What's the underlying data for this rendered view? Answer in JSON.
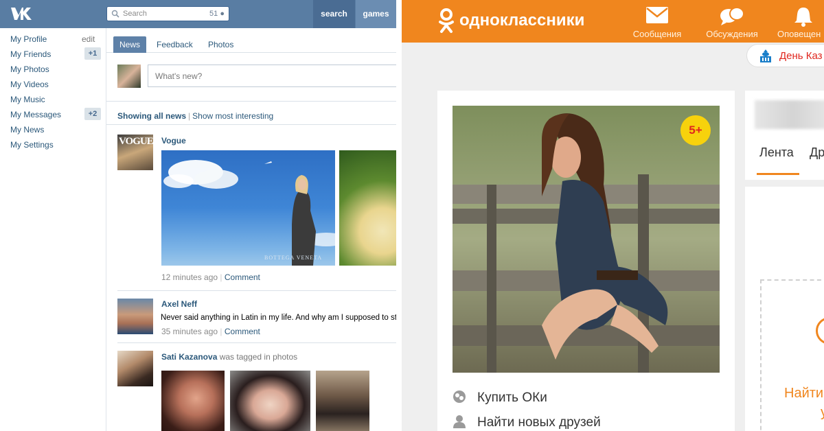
{
  "vk": {
    "search": {
      "placeholder": "Search",
      "count": "51"
    },
    "nav": {
      "search": "search",
      "games": "games"
    },
    "sidebar": {
      "edit": "edit",
      "items": [
        {
          "label": "My Profile"
        },
        {
          "label": "My Friends",
          "badge": "+1"
        },
        {
          "label": "My Photos"
        },
        {
          "label": "My Videos"
        },
        {
          "label": "My Music"
        },
        {
          "label": "My Messages",
          "badge": "+2"
        },
        {
          "label": "My News"
        },
        {
          "label": "My Settings"
        }
      ]
    },
    "tabs": [
      "News",
      "Feedback",
      "Photos"
    ],
    "composer": {
      "placeholder": "What's new?"
    },
    "feed_filter": {
      "active": "Showing all news",
      "separator": "|",
      "other": "Show most interesting"
    },
    "posts": [
      {
        "name": "Vogue",
        "time": "12 minutes ago",
        "comment": "Comment"
      },
      {
        "name": "Axel Neff",
        "text": "Never said anything in Latin in my life. And why am I supposed to st",
        "time": "35 minutes ago",
        "comment": "Comment"
      },
      {
        "name": "Sati Kazanova",
        "action": "was tagged in photos"
      }
    ],
    "vogue_logo": "VOGUE",
    "watermark": "BOTTEGA VENETA"
  },
  "ok": {
    "logo": "одноклассники",
    "nav": [
      "Сообщения",
      "Обсуждения",
      "Оповещен"
    ],
    "holiday": "День Каз",
    "badge": "5+",
    "menu": [
      "Купить ОКи",
      "Найти новых друзей"
    ],
    "tabs": [
      "Лента",
      "Др"
    ],
    "find": [
      "Найти",
      "у"
    ]
  },
  "colors": {
    "vk_blue": "#597da3",
    "ok_orange": "#f0861e",
    "link": "#2b587a"
  }
}
